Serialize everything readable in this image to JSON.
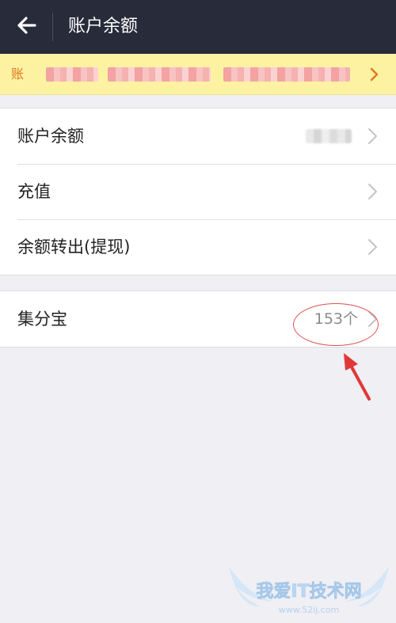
{
  "header": {
    "title": "账户余额",
    "back_icon": "arrow-left-icon"
  },
  "notice": {
    "text": "账"
  },
  "group1": {
    "rows": [
      {
        "label": "账户余额",
        "value": ""
      },
      {
        "label": "充值"
      },
      {
        "label": "余额转出(提现)"
      }
    ]
  },
  "group2": {
    "rows": [
      {
        "label": "集分宝",
        "value": "153个"
      }
    ]
  },
  "watermark": {
    "text": "我爱IT技术网",
    "url": "www.52ij.com"
  },
  "colors": {
    "header_bg": "#272b3a",
    "notice_bg": "#fdf2a2",
    "notice_text": "#e0771e",
    "page_bg": "#efeff4",
    "annotation": "#e04040"
  }
}
